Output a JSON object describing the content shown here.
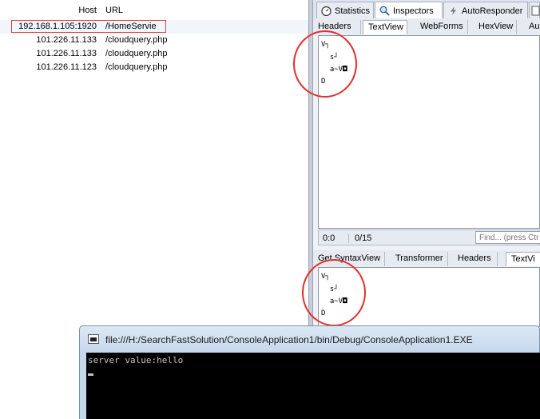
{
  "sessions": {
    "columns": {
      "host": "Host",
      "url": "URL"
    },
    "rows": [
      {
        "host": "192.168.1.105:1920",
        "url": "/HomeServie"
      },
      {
        "host": "101.226.11.133",
        "url": "/cloudquery.php"
      },
      {
        "host": "101.226.11.133",
        "url": "/cloudquery.php"
      },
      {
        "host": "101.226.11.123",
        "url": "/cloudquery.php"
      }
    ]
  },
  "inspectors": {
    "top_tabs": [
      "Statistics",
      "Inspectors",
      "AutoResponder"
    ],
    "request_tabs": [
      "Headers",
      "TextView",
      "WebForms",
      "HexView",
      "Au"
    ],
    "request_text": [
      "V┐",
      "  s┘",
      "  a~V◘",
      "D"
    ],
    "status": {
      "position": "0:0",
      "count": "0/15",
      "find_placeholder": "Find... (press Ctrl"
    },
    "response_tabs": [
      "Get SyntaxView",
      "Transformer",
      "Headers",
      "TextVi"
    ],
    "response_text": [
      "V┐",
      "  s┘",
      "  a~V◘",
      "D"
    ]
  },
  "console": {
    "title": "file:///H:/SearchFastSolution/ConsoleApplication1/bin/Debug/ConsoleApplication1.EXE",
    "output": "server value:hello"
  },
  "colors": {
    "annotation": "#e03030",
    "console_bg": "#000000",
    "selected_row": "#f2f6fb"
  }
}
